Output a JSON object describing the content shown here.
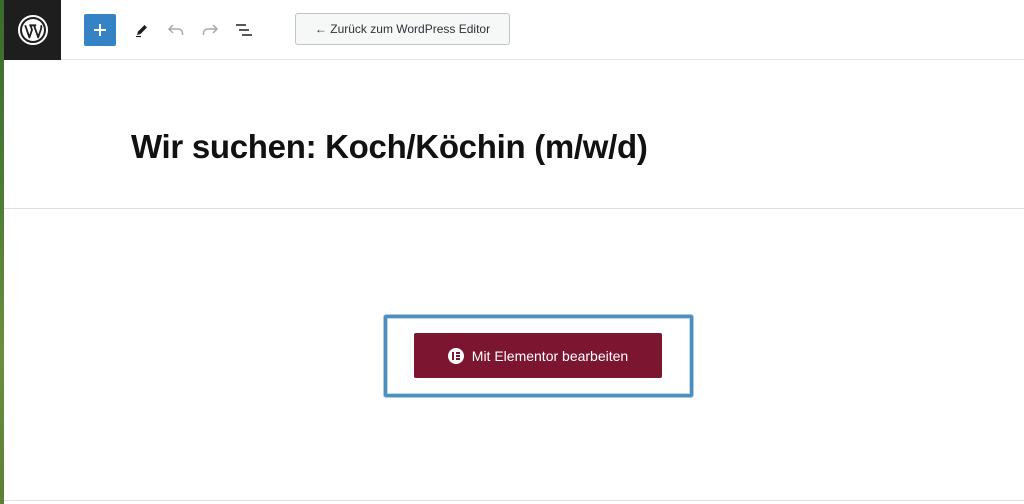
{
  "toolbar": {
    "back_label": "← Zurück zum WordPress Editor"
  },
  "post": {
    "title": "Wir suchen: Koch/Köchin (m/w/d)"
  },
  "elementor": {
    "button_label": "Mit Elementor bearbeiten"
  },
  "colors": {
    "toolbar_logo_bg": "#1e1e1e",
    "add_button": "#3582c4",
    "elementor_button": "#7b1530",
    "highlight_frame": "#4a8fbd"
  },
  "icons": [
    "wordpress-logo-icon",
    "plus-icon",
    "pen-icon",
    "undo-icon",
    "redo-icon",
    "list-view-icon",
    "elementor-icon"
  ]
}
